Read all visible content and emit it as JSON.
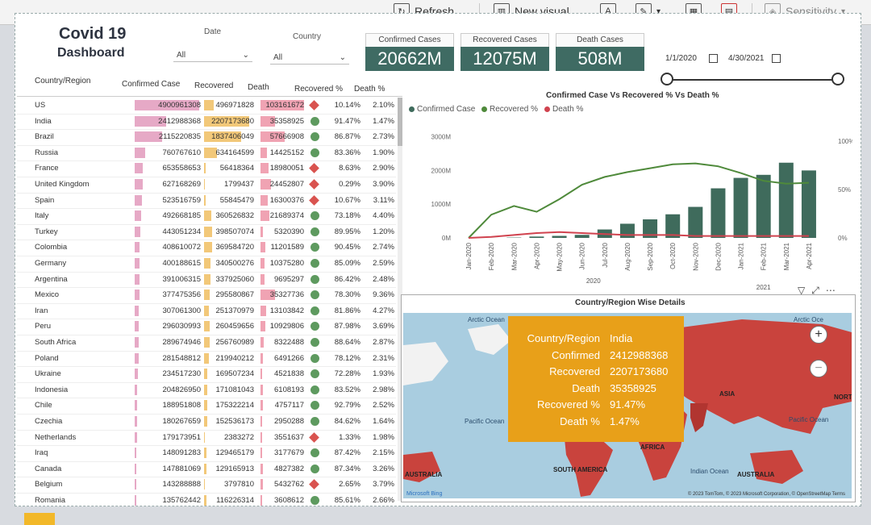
{
  "ribbon": {
    "refresh_label": "Refresh",
    "new_visual_label": "New visual",
    "sensitivity_label": "Sensitivity"
  },
  "header": {
    "title_line1": "Covid 19",
    "title_line2": "Dashboard",
    "date_label": "Date",
    "date_value": "All",
    "country_label": "Country",
    "country_value": "All"
  },
  "kpis": [
    {
      "label": "Confirmed Cases",
      "value": "20662M"
    },
    {
      "label": "Recovered Cases",
      "value": "12075M"
    },
    {
      "label": "Death Cases",
      "value": "508M"
    }
  ],
  "date_range": {
    "start": "1/1/2020",
    "end": "4/30/2021"
  },
  "table": {
    "headers": [
      "Country/Region",
      "Confirmed Case",
      "Recovered",
      "Death",
      "Recovered %",
      "Death %"
    ],
    "rows": [
      {
        "country": "US",
        "confirmed": "4900961308",
        "recovered": "496971828",
        "death": "103161672",
        "rec_pct": "10.14%",
        "death_pct": "2.10%",
        "ind": "diamond",
        "cf": 1.0,
        "rf": 0.22,
        "df": 1.0
      },
      {
        "country": "India",
        "confirmed": "2412988368",
        "recovered": "2207173680",
        "death": "35358925",
        "rec_pct": "91.47%",
        "death_pct": "1.47%",
        "ind": "circle",
        "cf": 0.49,
        "rf": 1.0,
        "df": 0.34
      },
      {
        "country": "Brazil",
        "confirmed": "2115220835",
        "recovered": "1837406049",
        "death": "57666908",
        "rec_pct": "86.87%",
        "death_pct": "2.73%",
        "ind": "circle",
        "cf": 0.43,
        "rf": 0.83,
        "df": 0.56
      },
      {
        "country": "Russia",
        "confirmed": "760767610",
        "recovered": "634164599",
        "death": "14425152",
        "rec_pct": "83.36%",
        "death_pct": "1.90%",
        "ind": "circle",
        "cf": 0.16,
        "rf": 0.29,
        "df": 0.14
      },
      {
        "country": "France",
        "confirmed": "653558653",
        "recovered": "56418364",
        "death": "18980051",
        "rec_pct": "8.63%",
        "death_pct": "2.90%",
        "ind": "diamond",
        "cf": 0.13,
        "rf": 0.03,
        "df": 0.18
      },
      {
        "country": "United Kingdom",
        "confirmed": "627168269",
        "recovered": "1799437",
        "death": "24452807",
        "rec_pct": "0.29%",
        "death_pct": "3.90%",
        "ind": "diamond",
        "cf": 0.13,
        "rf": 0.01,
        "df": 0.24
      },
      {
        "country": "Spain",
        "confirmed": "523516759",
        "recovered": "55845479",
        "death": "16300376",
        "rec_pct": "10.67%",
        "death_pct": "3.11%",
        "ind": "diamond",
        "cf": 0.11,
        "rf": 0.03,
        "df": 0.16
      },
      {
        "country": "Italy",
        "confirmed": "492668185",
        "recovered": "360526832",
        "death": "21689374",
        "rec_pct": "73.18%",
        "death_pct": "4.40%",
        "ind": "circle",
        "cf": 0.1,
        "rf": 0.16,
        "df": 0.21
      },
      {
        "country": "Turkey",
        "confirmed": "443051234",
        "recovered": "398507074",
        "death": "5320390",
        "rec_pct": "89.95%",
        "death_pct": "1.20%",
        "ind": "circle",
        "cf": 0.09,
        "rf": 0.18,
        "df": 0.05
      },
      {
        "country": "Colombia",
        "confirmed": "408610072",
        "recovered": "369584720",
        "death": "11201589",
        "rec_pct": "90.45%",
        "death_pct": "2.74%",
        "ind": "circle",
        "cf": 0.08,
        "rf": 0.17,
        "df": 0.11
      },
      {
        "country": "Germany",
        "confirmed": "400188615",
        "recovered": "340500276",
        "death": "10375280",
        "rec_pct": "85.09%",
        "death_pct": "2.59%",
        "ind": "circle",
        "cf": 0.08,
        "rf": 0.15,
        "df": 0.1
      },
      {
        "country": "Argentina",
        "confirmed": "391006315",
        "recovered": "337925060",
        "death": "9695297",
        "rec_pct": "86.42%",
        "death_pct": "2.48%",
        "ind": "circle",
        "cf": 0.08,
        "rf": 0.15,
        "df": 0.09
      },
      {
        "country": "Mexico",
        "confirmed": "377475356",
        "recovered": "295580867",
        "death": "35327736",
        "rec_pct": "78.30%",
        "death_pct": "9.36%",
        "ind": "circle",
        "cf": 0.08,
        "rf": 0.13,
        "df": 0.34
      },
      {
        "country": "Iran",
        "confirmed": "307061300",
        "recovered": "251370979",
        "death": "13103842",
        "rec_pct": "81.86%",
        "death_pct": "4.27%",
        "ind": "circle",
        "cf": 0.06,
        "rf": 0.11,
        "df": 0.13
      },
      {
        "country": "Peru",
        "confirmed": "296030993",
        "recovered": "260459656",
        "death": "10929806",
        "rec_pct": "87.98%",
        "death_pct": "3.69%",
        "ind": "circle",
        "cf": 0.06,
        "rf": 0.12,
        "df": 0.11
      },
      {
        "country": "South Africa",
        "confirmed": "289674946",
        "recovered": "256760989",
        "death": "8322488",
        "rec_pct": "88.64%",
        "death_pct": "2.87%",
        "ind": "circle",
        "cf": 0.06,
        "rf": 0.12,
        "df": 0.08
      },
      {
        "country": "Poland",
        "confirmed": "281548812",
        "recovered": "219940212",
        "death": "6491266",
        "rec_pct": "78.12%",
        "death_pct": "2.31%",
        "ind": "circle",
        "cf": 0.06,
        "rf": 0.1,
        "df": 0.06
      },
      {
        "country": "Ukraine",
        "confirmed": "234517230",
        "recovered": "169507234",
        "death": "4521838",
        "rec_pct": "72.28%",
        "death_pct": "1.93%",
        "ind": "circle",
        "cf": 0.05,
        "rf": 0.08,
        "df": 0.04
      },
      {
        "country": "Indonesia",
        "confirmed": "204826950",
        "recovered": "171081043",
        "death": "6108193",
        "rec_pct": "83.52%",
        "death_pct": "2.98%",
        "ind": "circle",
        "cf": 0.04,
        "rf": 0.08,
        "df": 0.06
      },
      {
        "country": "Chile",
        "confirmed": "188951808",
        "recovered": "175322214",
        "death": "4757117",
        "rec_pct": "92.79%",
        "death_pct": "2.52%",
        "ind": "circle",
        "cf": 0.04,
        "rf": 0.08,
        "df": 0.05
      },
      {
        "country": "Czechia",
        "confirmed": "180267659",
        "recovered": "152536173",
        "death": "2950288",
        "rec_pct": "84.62%",
        "death_pct": "1.64%",
        "ind": "circle",
        "cf": 0.04,
        "rf": 0.07,
        "df": 0.03
      },
      {
        "country": "Netherlands",
        "confirmed": "179173951",
        "recovered": "2383272",
        "death": "3551637",
        "rec_pct": "1.33%",
        "death_pct": "1.98%",
        "ind": "diamond",
        "cf": 0.04,
        "rf": 0.01,
        "df": 0.03
      },
      {
        "country": "Iraq",
        "confirmed": "148091283",
        "recovered": "129465179",
        "death": "3177679",
        "rec_pct": "87.42%",
        "death_pct": "2.15%",
        "ind": "circle",
        "cf": 0.03,
        "rf": 0.06,
        "df": 0.03
      },
      {
        "country": "Canada",
        "confirmed": "147881069",
        "recovered": "129165913",
        "death": "4827382",
        "rec_pct": "87.34%",
        "death_pct": "3.26%",
        "ind": "circle",
        "cf": 0.03,
        "rf": 0.06,
        "df": 0.05
      },
      {
        "country": "Belgium",
        "confirmed": "143288888",
        "recovered": "3797810",
        "death": "5432762",
        "rec_pct": "2.65%",
        "death_pct": "3.79%",
        "ind": "diamond",
        "cf": 0.03,
        "rf": 0.01,
        "df": 0.05
      },
      {
        "country": "Romania",
        "confirmed": "135762442",
        "recovered": "116226314",
        "death": "3608612",
        "rec_pct": "85.61%",
        "death_pct": "2.66%",
        "ind": "circle",
        "cf": 0.03,
        "rf": 0.05,
        "df": 0.03
      }
    ]
  },
  "chart_data": {
    "type": "bar",
    "title": "Confirmed Case Vs Recovered % Vs Death %",
    "categories": [
      "Jan-2020",
      "Feb-2020",
      "Mar-2020",
      "Apr-2020",
      "May-2020",
      "Jun-2020",
      "Jul-2020",
      "Aug-2020",
      "Sep-2020",
      "Oct-2020",
      "Nov-2020",
      "Dec-2020",
      "Jan-2021",
      "Feb-2021",
      "Mar-2021",
      "Apr-2021"
    ],
    "year_labels": [
      "2020",
      "2021"
    ],
    "series": [
      {
        "name": "Confirmed Case",
        "kind": "bar",
        "axis": "left",
        "color": "#3f6b5c",
        "values": [
          0,
          1,
          10,
          40,
          60,
          90,
          250,
          420,
          550,
          700,
          920,
          1470,
          1780,
          1870,
          2230,
          2000
        ]
      },
      {
        "name": "Recovered %",
        "kind": "line",
        "axis": "right",
        "color": "#4f8a3b",
        "values": [
          0,
          24,
          33,
          27,
          40,
          55,
          63,
          68,
          72,
          76,
          77,
          74,
          67,
          59,
          56,
          57
        ]
      },
      {
        "name": "Death %",
        "kind": "line",
        "axis": "right",
        "color": "#d0434f",
        "values": [
          0,
          1,
          3,
          5,
          6,
          5,
          4,
          3,
          3,
          3,
          2,
          2,
          2,
          2,
          2,
          2
        ]
      }
    ],
    "left_axis": {
      "ticks": [
        "0M",
        "1000M",
        "2000M",
        "3000M"
      ],
      "ylim": [
        0,
        3300
      ]
    },
    "right_axis": {
      "ticks": [
        "0%",
        "50%",
        "100%"
      ],
      "ylim": [
        0,
        115
      ]
    }
  },
  "map": {
    "title": "Country/Region Wise Details",
    "tooltip": [
      {
        "k": "Country/Region",
        "v": "India"
      },
      {
        "k": "Confirmed",
        "v": "2412988368"
      },
      {
        "k": "Recovered",
        "v": "2207173680"
      },
      {
        "k": "Death",
        "v": "35358925"
      },
      {
        "k": "Recovered %",
        "v": "91.47%"
      },
      {
        "k": "Death %",
        "v": "1.47%"
      }
    ],
    "labels": {
      "arctic_left": "Arctic Ocean",
      "arctic_right": "Arctic Oce",
      "pacific_left": "Pacific Ocean",
      "pacific_right": "Pacific Ocean",
      "asia": "ASIA",
      "africa": "AFRICA",
      "south_america": "SOUTH AMERICA",
      "australia_left": "AUSTRALIA",
      "australia_right": "AUSTRALIA",
      "indian": "Indian Ocean",
      "north": "NORT"
    },
    "copyright": "© 2023 TomTom, © 2023 Microsoft Corporation, © OpenStreetMap  Terms",
    "bing": "Microsoft Bing"
  },
  "colors": {
    "kpi_bg": "#3f6b63",
    "tooltip_bg": "#e8a019",
    "country_fill": "#c9433d",
    "ocean": "#a9cde0"
  }
}
